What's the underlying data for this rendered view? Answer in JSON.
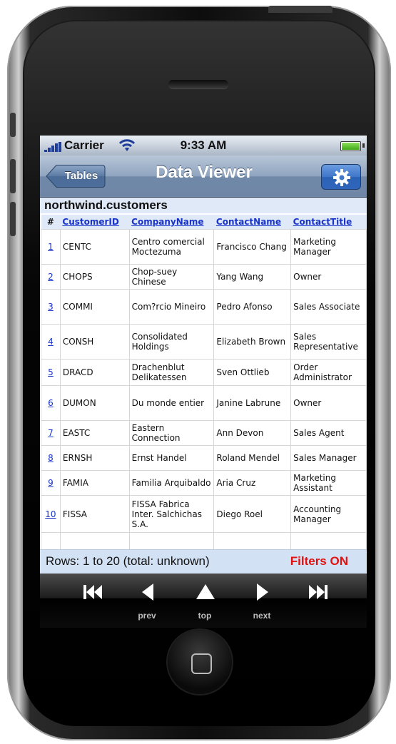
{
  "status": {
    "carrier": "Carrier",
    "time": "9:33 AM"
  },
  "nav": {
    "back_label": "Tables",
    "title": "Data Viewer"
  },
  "table": {
    "title": "northwind.customers",
    "headers": [
      "#",
      "CustomerID",
      "CompanyName",
      "ContactName",
      "ContactTitle"
    ],
    "rows": [
      {
        "n": "1",
        "id": "CENTC",
        "company": "Centro comercial Moctezuma",
        "contact": "Francisco Chang",
        "title": "Marketing Manager"
      },
      {
        "n": "2",
        "id": "CHOPS",
        "company": "Chop-suey Chinese",
        "contact": "Yang Wang",
        "title": "Owner"
      },
      {
        "n": "3",
        "id": "COMMI",
        "company": "Com?rcio Mineiro",
        "contact": "Pedro Afonso",
        "title": "Sales Associate"
      },
      {
        "n": "4",
        "id": "CONSH",
        "company": "Consolidated Holdings",
        "contact": "Elizabeth Brown",
        "title": "Sales Representative"
      },
      {
        "n": "5",
        "id": "DRACD",
        "company": "Drachenblut Delikatessen",
        "contact": "Sven Ottlieb",
        "title": "Order Administrator"
      },
      {
        "n": "6",
        "id": "DUMON",
        "company": "Du monde entier",
        "contact": "Janine Labrune",
        "title": "Owner"
      },
      {
        "n": "7",
        "id": "EASTC",
        "company": "Eastern Connection",
        "contact": "Ann Devon",
        "title": "Sales Agent"
      },
      {
        "n": "8",
        "id": "ERNSH",
        "company": "Ernst Handel",
        "contact": "Roland Mendel",
        "title": "Sales Manager"
      },
      {
        "n": "9",
        "id": "FAMIA",
        "company": "Familia Arquibaldo",
        "contact": "Aria Cruz",
        "title": "Marketing Assistant"
      },
      {
        "n": "10",
        "id": "FISSA",
        "company": "FISSA Fabrica Inter. Salchichas S.A.",
        "contact": "Diego Roel",
        "title": "Accounting Manager"
      }
    ]
  },
  "footer": {
    "rows_text": "Rows: 1 to 20 (total: unknown)",
    "filters_text": "Filters ON"
  },
  "toolbar": {
    "prev_label": "prev",
    "top_label": "top",
    "next_label": "next"
  },
  "colors": {
    "link": "#1a33c9",
    "filters": "#e31010",
    "header_bg": "#dfe9f8"
  },
  "icons": [
    "signal-bars-icon",
    "wifi-icon",
    "battery-icon",
    "gear-icon",
    "first-page-icon",
    "prev-icon",
    "top-icon",
    "next-icon",
    "last-page-icon",
    "home-button-icon"
  ]
}
